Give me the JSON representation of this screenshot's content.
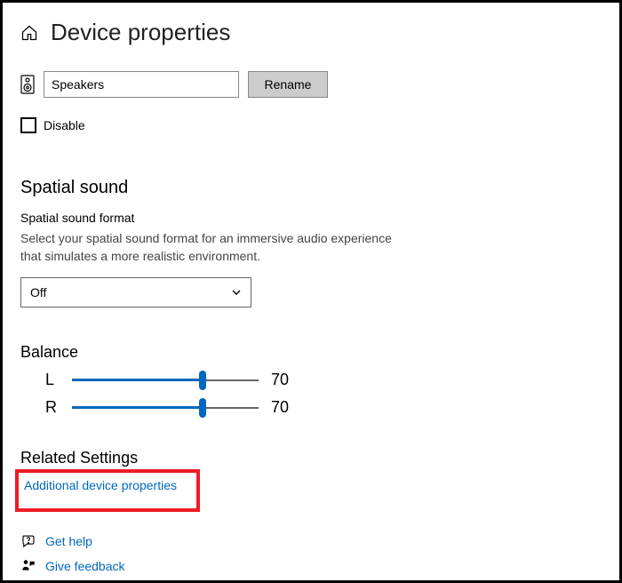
{
  "header": {
    "title": "Device properties"
  },
  "device": {
    "name": "Speakers",
    "rename_label": "Rename"
  },
  "disable": {
    "label": "Disable",
    "checked": false
  },
  "spatial": {
    "section_title": "Spatial sound",
    "field_label": "Spatial sound format",
    "description": "Select your spatial sound format for an immersive audio experience that simulates a more realistic environment.",
    "selected": "Off"
  },
  "balance": {
    "title": "Balance",
    "left_label": "L",
    "left_value": 70,
    "right_label": "R",
    "right_value": 70
  },
  "related": {
    "title": "Related Settings",
    "additional_link": "Additional device properties"
  },
  "footer": {
    "help_label": "Get help",
    "feedback_label": "Give feedback"
  },
  "colors": {
    "accent": "#0067c0",
    "highlight": "#ec1c24"
  }
}
